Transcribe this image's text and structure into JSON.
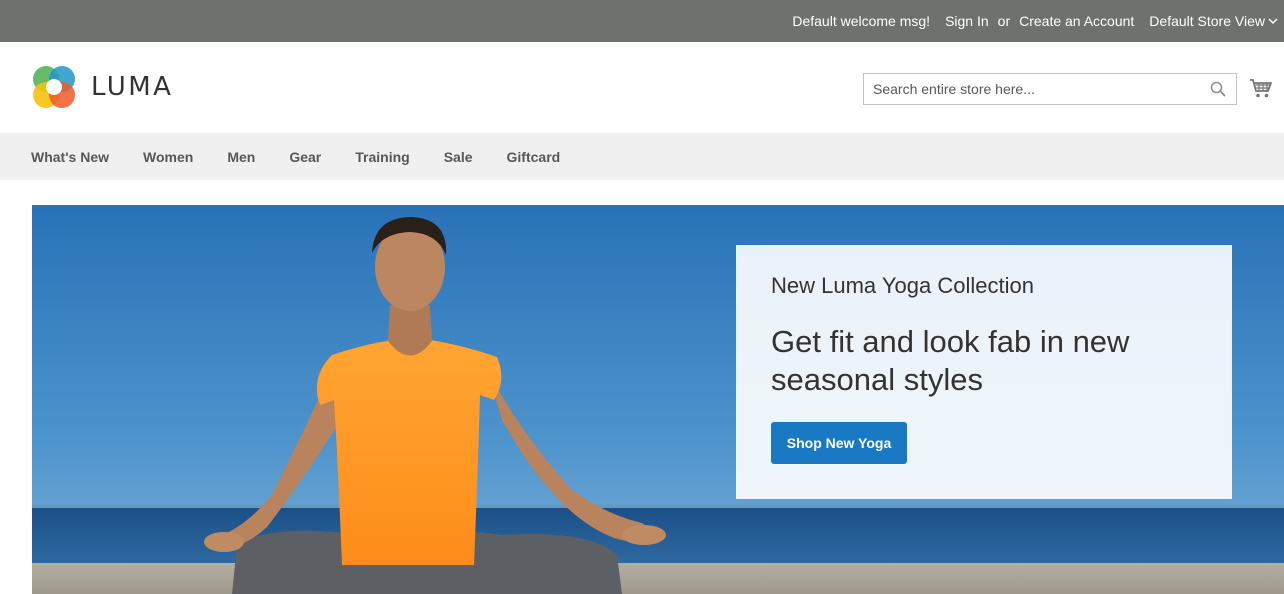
{
  "topbar": {
    "welcome": "Default welcome msg!",
    "sign_in": "Sign In",
    "or": "or",
    "create_account": "Create an Account",
    "store_view": "Default Store View"
  },
  "header": {
    "logo_text": "LUMA",
    "search": {
      "placeholder": "Search entire store here..."
    }
  },
  "nav": {
    "items": [
      "What's New",
      "Women",
      "Men",
      "Gear",
      "Training",
      "Sale",
      "Giftcard"
    ]
  },
  "hero": {
    "subtitle": "New Luma Yoga Collection",
    "headline": "Get fit and look fab in new seasonal styles",
    "cta": "Shop New Yoga"
  },
  "colors": {
    "topbar_bg": "#6e716e",
    "nav_bg": "#f0f0f0",
    "cta_bg": "#1979c3",
    "shirt": "#ff9a2a",
    "sky": "#3a82c0"
  },
  "icons": {
    "search": "search-icon",
    "cart": "cart-icon",
    "store_dropdown": "chevron-down-icon",
    "logo": "luma-logo-icon"
  }
}
